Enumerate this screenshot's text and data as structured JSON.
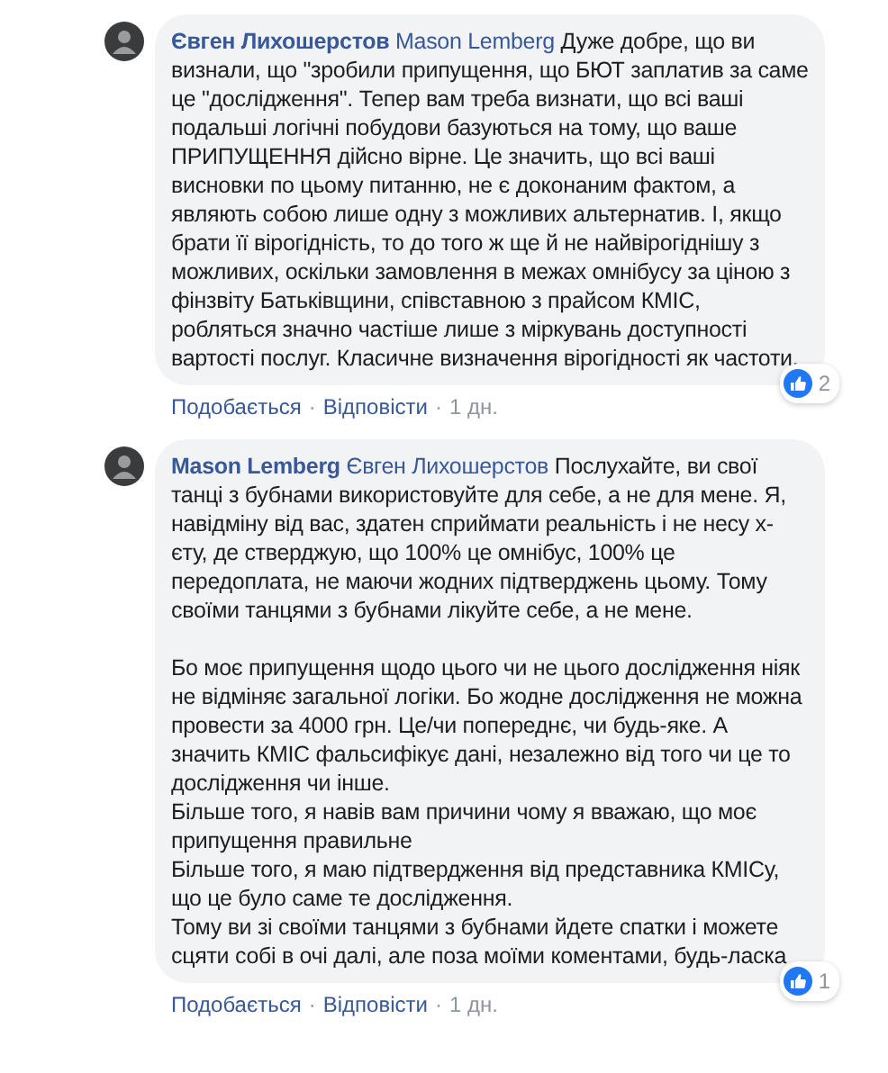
{
  "comments": [
    {
      "author": "Євген Лихошерстов",
      "mention": "Mason Lemberg",
      "paragraphs": [
        [
          "Дуже добре, що ви визнали, що \"зробили припущення, що БЮТ заплатив за саме це \"дослідження\". Тепер вам треба визнати, що всі ваші подальші логічні побудови базуються на тому, що ваше ПРИПУЩЕННЯ дійсно вірне. Це значить, що всі ваші висновки по цьому питанню, не є доконаним фактом, а являють собою лише одну з можливих альтернатив. І, якщо брати її вірогідність, то до того ж ще й не найвірогіднішу з можливих, оскільки замовлення в межах омнібусу за ціною з фінзвіту Батьківщини, співставною з прайсом КМІС, робляться значно частіше лише з міркувань доступності вартості послуг. Класичне визначення вірогідності як частоти."
        ]
      ],
      "reactions": "2",
      "like": "Подобається",
      "reply": "Відповісти",
      "time": "1 дн.",
      "separator": "·"
    },
    {
      "author": "Mason Lemberg",
      "mention": "Євген Лихошерстов",
      "paragraphs": [
        [
          "Послухайте, ви свої танці з бубнами використовуйте для себе, а не для мене. Я, навідміну від вас, здатен сприймати реальність і не несу х-єту, де стверджую, що 100% це омнібус, 100% це передоплата, не маючи жодних підтверджень цьому. Тому своїми танцями з бубнами лікуйте себе, а не мене."
        ],
        [
          "Бо моє припущення щодо цього чи не цього дослідження ніяк не відміняє загальної логіки. Бо жодне дослідження не можна провести за 4000 грн. Це/чи попереднє, чи будь-яке. А значить КМІС фальсифікує дані, незалежно від того чи це то дослідження чи інше.",
          "Більше того, я навів вам причини чому я вважаю, що моє припущення правильне",
          "Більше того, я маю підтвердження від представника КМІСу, що це було саме те дослідження.",
          "Тому ви зі своїми танцями з бубнами йдете спатки і можете сцяти собі в очі далі, але поза моїми коментами, будь-ласка"
        ]
      ],
      "reactions": "1",
      "like": "Подобається",
      "reply": "Відповісти",
      "time": "1 дн.",
      "separator": "·"
    }
  ]
}
